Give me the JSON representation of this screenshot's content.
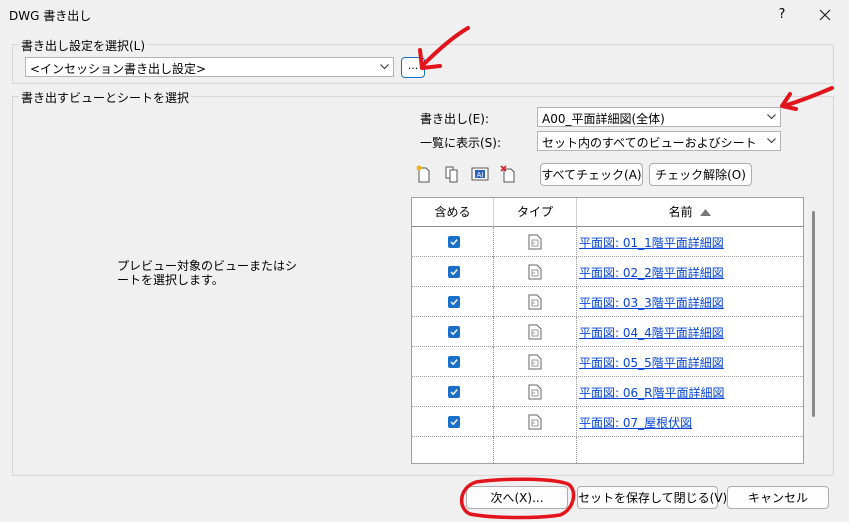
{
  "window": {
    "title": "DWG 書き出し",
    "help": "?",
    "close": "×"
  },
  "export_setup": {
    "legend": "書き出し設定を選択(L)",
    "value": "<インセッション書き出し設定>",
    "browse": "..."
  },
  "views": {
    "legend": "書き出すビューとシートを選択",
    "preview_text": "プレビュー対象のビューまたはシートを選択します。",
    "export_label": "書き出し(E):",
    "export_value": "A00_平面詳細図(全体)",
    "show_label": "一覧に表示(S):",
    "show_value": "セット内のすべてのビューおよびシート",
    "check_all": "すべてチェック(A)",
    "uncheck_all": "チェック解除(O)",
    "columns": {
      "include": "含める",
      "type": "タイプ",
      "name": "名前"
    },
    "rows": [
      {
        "name": "平面図: 01_1階平面詳細図",
        "checked": true
      },
      {
        "name": "平面図: 02_2階平面詳細図",
        "checked": true
      },
      {
        "name": "平面図: 03_3階平面詳細図",
        "checked": true
      },
      {
        "name": "平面図: 04_4階平面詳細図",
        "checked": true
      },
      {
        "name": "平面図: 05_5階平面詳細図",
        "checked": true
      },
      {
        "name": "平面図: 06_R階平面詳細図",
        "checked": true
      },
      {
        "name": "平面図: 07_屋根伏図",
        "checked": true
      }
    ]
  },
  "footer": {
    "next": "次へ(X)...",
    "save_close": "セットを保存して閉じる(V)",
    "cancel": "キャンセル"
  },
  "colors": {
    "accent": "#1a6fc9",
    "link": "#0645d6",
    "annotation": "#e3141c"
  }
}
